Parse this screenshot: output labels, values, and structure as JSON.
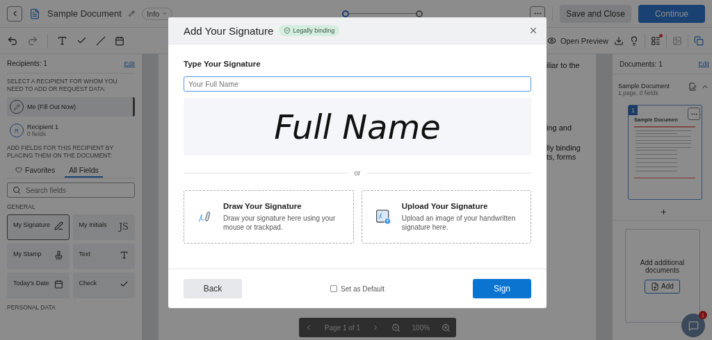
{
  "header": {
    "document_title": "Sample Document",
    "info": "Info",
    "steps": [
      {
        "selected": true
      },
      {
        "selected": false
      }
    ],
    "save": "Save and Close",
    "continue": "Continue"
  },
  "toolbar": {
    "preview": "Open Preview"
  },
  "left_panel": {
    "title": "Recipients: 1",
    "edit": "Edit",
    "select_heading": "SELECT A RECIPIENT FOR WHOM YOU NEED TO ADD OR REQUEST DATA:",
    "recipients": [
      {
        "kind": "self",
        "name": "Me (Fill Out Now)",
        "selected": true
      },
      {
        "kind": "recipient",
        "name": "Recipient 1",
        "initial": "R",
        "fields": "0 fields",
        "selected": false
      }
    ],
    "add_heading": "ADD FIELDS FOR THIS RECIPIENT BY PLACING THEM ON THE DOCUMENT:",
    "tabs": [
      {
        "kind": "favorites",
        "label": "Favorites",
        "selected": false
      },
      {
        "kind": "all",
        "label": "All Fields",
        "selected": true
      }
    ],
    "search": {
      "placeholder": "Search fields"
    },
    "sections": [
      {
        "title": "GENERAL",
        "fields": [
          {
            "kind": "signature",
            "label": "My Signature",
            "selected": true
          },
          {
            "kind": "initials",
            "label": "My Initials",
            "glyph": "JS",
            "selected": false
          },
          {
            "kind": "stamp",
            "label": "My Stamp",
            "selected": false
          },
          {
            "kind": "text",
            "label": "Text",
            "selected": false
          },
          {
            "kind": "date",
            "label": "Today's Date",
            "selected": false
          },
          {
            "kind": "check",
            "label": "Check",
            "selected": false
          }
        ]
      },
      {
        "title": "PERSONAL DATA"
      }
    ]
  },
  "document": {
    "lines": [
      "iliar to the",
      "ing and",
      "lly binding",
      "ts, forms"
    ]
  },
  "page_nav": {
    "page": "Page 1 of 1",
    "zoom": "100%"
  },
  "right_panel": {
    "title": "Documents: 1",
    "edit": "Edit",
    "documents": [
      {
        "name": "Sample Document",
        "meta": "1 page, 0 fields",
        "expanded": true,
        "page_number": "1",
        "thumb_title": "Sample Documen"
      }
    ],
    "add_title": "Add additional documents",
    "add": "Add"
  },
  "chat": {
    "badge": "1"
  },
  "modal": {
    "title": "Add Your Signature",
    "badge": "Legally binding",
    "section": "Type Your Signature",
    "input": {
      "placeholder": "Your Full Name"
    },
    "preview": "Full Name",
    "divider": "or",
    "options": [
      {
        "kind": "draw",
        "title": "Draw Your Signature",
        "description": "Draw your signature here using your mouse or trackpad."
      },
      {
        "kind": "upload",
        "title": "Upload Your Signature",
        "description": "Upload an image of your handwritten signature here."
      }
    ],
    "back": "Back",
    "default": {
      "label": "Set as Default",
      "checked": false
    },
    "sign": "Sign"
  }
}
